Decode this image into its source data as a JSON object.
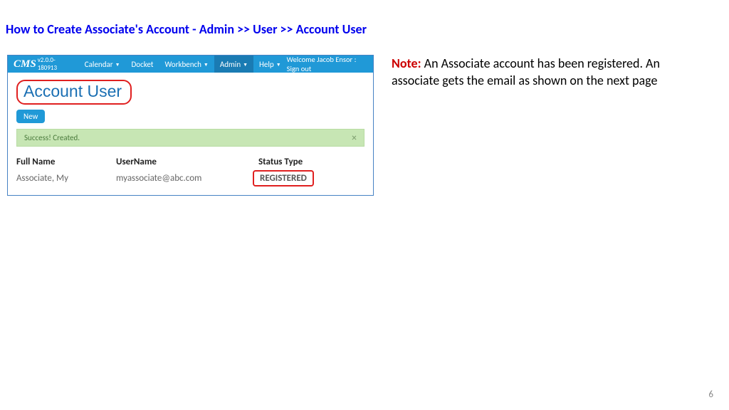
{
  "title": {
    "prefix": "How to Create Associate's Account  - ",
    "crumb1": "Admin",
    "sep": " >> ",
    "crumb2": "User",
    "crumb3": "Account User"
  },
  "nav": {
    "brand": "CMS",
    "version": "v2.0.0-180913",
    "items": [
      "Calendar",
      "Docket",
      "Workbench",
      "Admin",
      "Help"
    ],
    "welcome": "Welcome Jacob Ensor : Sign out"
  },
  "page": {
    "heading": "Account User",
    "newBtn": "New",
    "alert": "Success! Created.",
    "alertClose": "×"
  },
  "table": {
    "headers": {
      "name": "Full Name",
      "user": "UserName",
      "status": "Status Type"
    },
    "row": {
      "name": "Associate, My",
      "user": "myassociate@abc.com",
      "status": "REGISTERED"
    }
  },
  "note": {
    "label": "Note:",
    "text": " An Associate account has been registered. An associate gets the email as shown on the next page"
  },
  "pageNumber": "6"
}
